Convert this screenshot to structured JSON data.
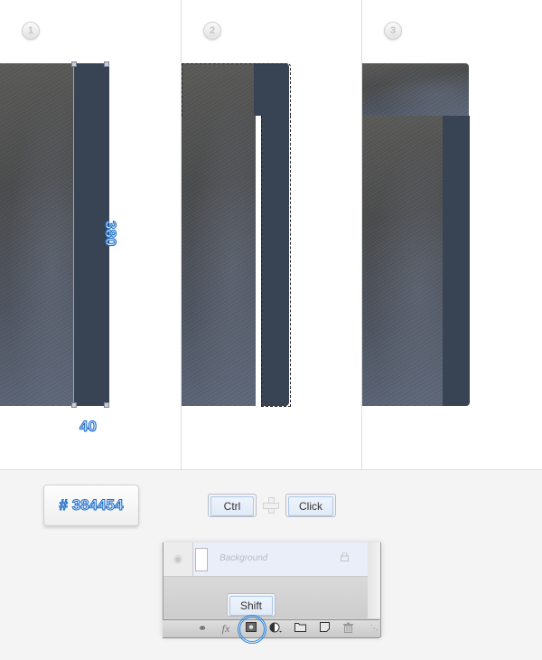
{
  "steps": [
    {
      "number": "1"
    },
    {
      "number": "2"
    },
    {
      "number": "3"
    }
  ],
  "dimensions": {
    "height_label": "380",
    "width_label": "40"
  },
  "color_badge": {
    "label": "# 384454",
    "color": "#384454"
  },
  "shortcut": {
    "key1": "Ctrl",
    "key2": "Click",
    "modifier": "Shift"
  },
  "layers_panel": {
    "layer_name": "Background",
    "toolbar_icons": [
      "link-icon",
      "fx-icon",
      "add-mask-icon",
      "adjustment-layer-icon",
      "new-group-icon",
      "new-layer-icon",
      "trash-icon"
    ],
    "highlighted_icon": "add-mask-icon"
  },
  "colors": {
    "bar": "#384454",
    "accent": "#2d8ae0"
  }
}
